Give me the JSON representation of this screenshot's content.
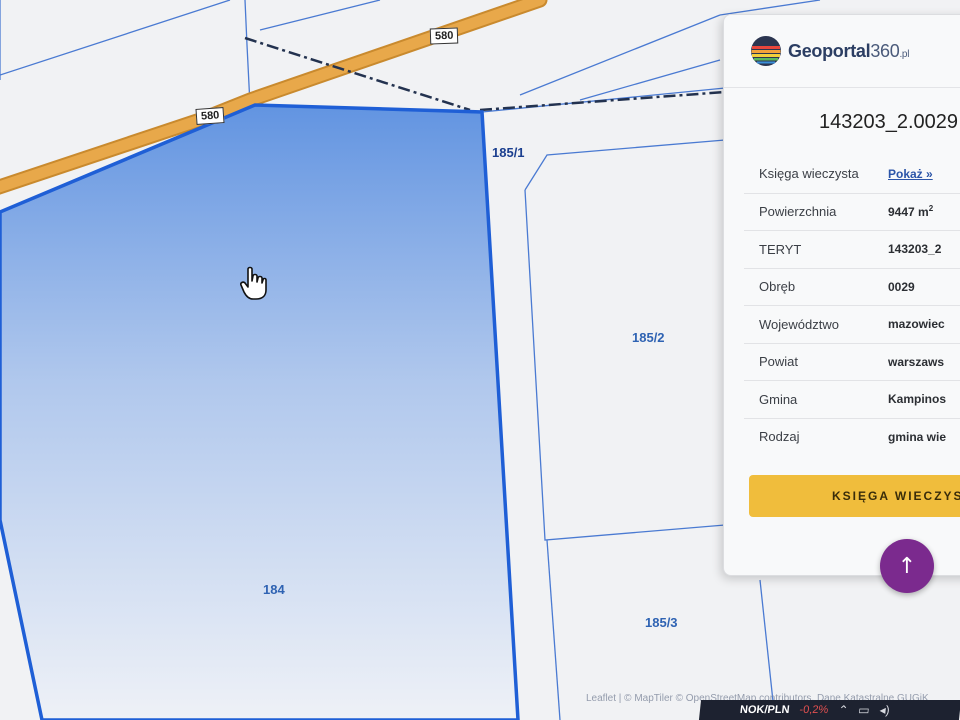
{
  "map": {
    "road_shields": [
      "580",
      "580"
    ],
    "parcel_labels": {
      "p1851": "185/1",
      "p1852": "185/2",
      "p184": "184",
      "p1853": "185/3"
    },
    "attribution": "Leaflet | © MapTiler © OpenStreetMap contributors, Dane Katastralne GUGiK",
    "colors": {
      "selected_parcel_fill_top": "#5a8fe0",
      "selected_parcel_fill_bottom": "#eef1f7",
      "selected_parcel_stroke": "#1f5fd6",
      "parcel_line": "#4a7ad2",
      "road": "#e8a84a"
    }
  },
  "popup": {
    "brand": {
      "name": "Geoportal",
      "num": "360",
      "tld": ".pl"
    },
    "parcel_id": "143203_2.0029",
    "rows": [
      {
        "key": "Księga wieczysta",
        "value": "Pokaż »",
        "link": true
      },
      {
        "key": "Powierzchnia",
        "value": "9447 m",
        "sup": "2"
      },
      {
        "key": "TERYT",
        "value": "143203_2"
      },
      {
        "key": "Obręb",
        "value": "0029"
      },
      {
        "key": "Województwo",
        "value": "mazowiec"
      },
      {
        "key": "Powiat",
        "value": "warszaws"
      },
      {
        "key": "Gmina",
        "value": "Kampinos"
      },
      {
        "key": "Rodzaj",
        "value": "gmina wie"
      }
    ],
    "kw_button_label": "KSIĘGA WIECZYSTA",
    "accent": "#f0bd3c"
  },
  "fab": {
    "icon": "arrow-up-icon",
    "glyph": "↑",
    "color": "#7b2a8e"
  },
  "taskbar": {
    "ticker": "NOK/PLN",
    "change": "-0,2%",
    "icons": [
      "chevron-up-icon",
      "network-icon",
      "volume-icon"
    ]
  }
}
